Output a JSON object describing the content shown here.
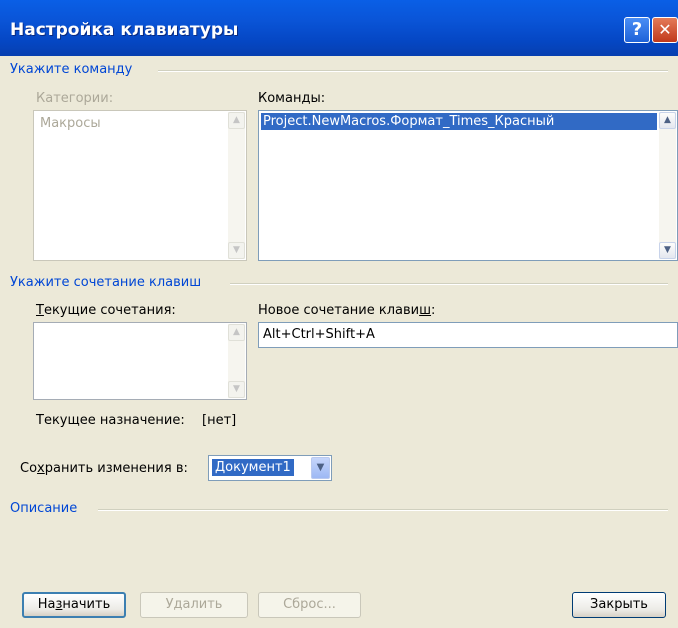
{
  "window": {
    "title": "Настройка клавиатуры",
    "help_icon": "?",
    "close_icon": "✕"
  },
  "command_group": {
    "legend": "Укажите команду",
    "categories_label": "Категории:",
    "categories_items": [
      "Макросы"
    ],
    "commands_label_prefix": "Коман",
    "commands_label_accel": "д",
    "commands_label_rest": "ы:",
    "commands_items": [
      "Project.NewMacros.Формат_Times_Красный"
    ]
  },
  "shortcut_group": {
    "legend": "Укажите сочетание клавиш",
    "current_label_accel": "Т",
    "current_label_rest": "екущие сочетания:",
    "new_label_prefix": "Новое сочетание клави",
    "new_label_accel": "ш",
    "new_label_rest": ":",
    "new_value": "Alt+Ctrl+Shift+A",
    "assignment_label": "Текущее назначение:",
    "assignment_value": "[нет]"
  },
  "save_in": {
    "label_prefix": "Со",
    "label_accel": "х",
    "label_rest": "ранить изменения в:",
    "selected": "Документ1"
  },
  "description_group": {
    "legend": "Описание"
  },
  "buttons": {
    "assign_prefix": "На",
    "assign_accel": "з",
    "assign_rest": "начить",
    "remove": "Удалить",
    "reset": "Сброс...",
    "close": "Закрыть"
  },
  "icons": {
    "scroll_up": "▲",
    "scroll_down": "▼",
    "dropdown": "▼"
  }
}
